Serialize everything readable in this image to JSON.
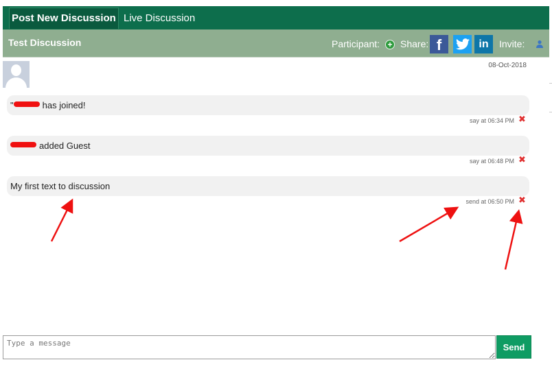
{
  "tabs": [
    {
      "label": "Post New Discussion",
      "active": true
    },
    {
      "label": "Live Discussion",
      "active": false
    }
  ],
  "header": {
    "title": "Test Discussion",
    "participant_label": "Participant:",
    "share_label": "Share:",
    "invite_label": "Invite:",
    "social": {
      "facebook": "f",
      "twitter": "t",
      "linkedin": "in"
    }
  },
  "date": "08-Oct-2018",
  "messages": [
    {
      "prefix": "\"",
      "text": "has joined!",
      "meta": "say at 06:34 PM",
      "redacted": true
    },
    {
      "prefix": "",
      "text": "added Guest",
      "meta": "say at 06:48 PM",
      "redacted": true
    },
    {
      "prefix": "",
      "text": "My  first  text  to  discussion",
      "meta": "send at 06:50 PM",
      "redacted": false
    }
  ],
  "composer": {
    "placeholder": "Type a message",
    "send_label": "Send"
  },
  "colors": {
    "tabbar": "#0d6e4c",
    "header": "#8fae90",
    "send": "#0f9c63",
    "annotation": "#ee1111"
  }
}
